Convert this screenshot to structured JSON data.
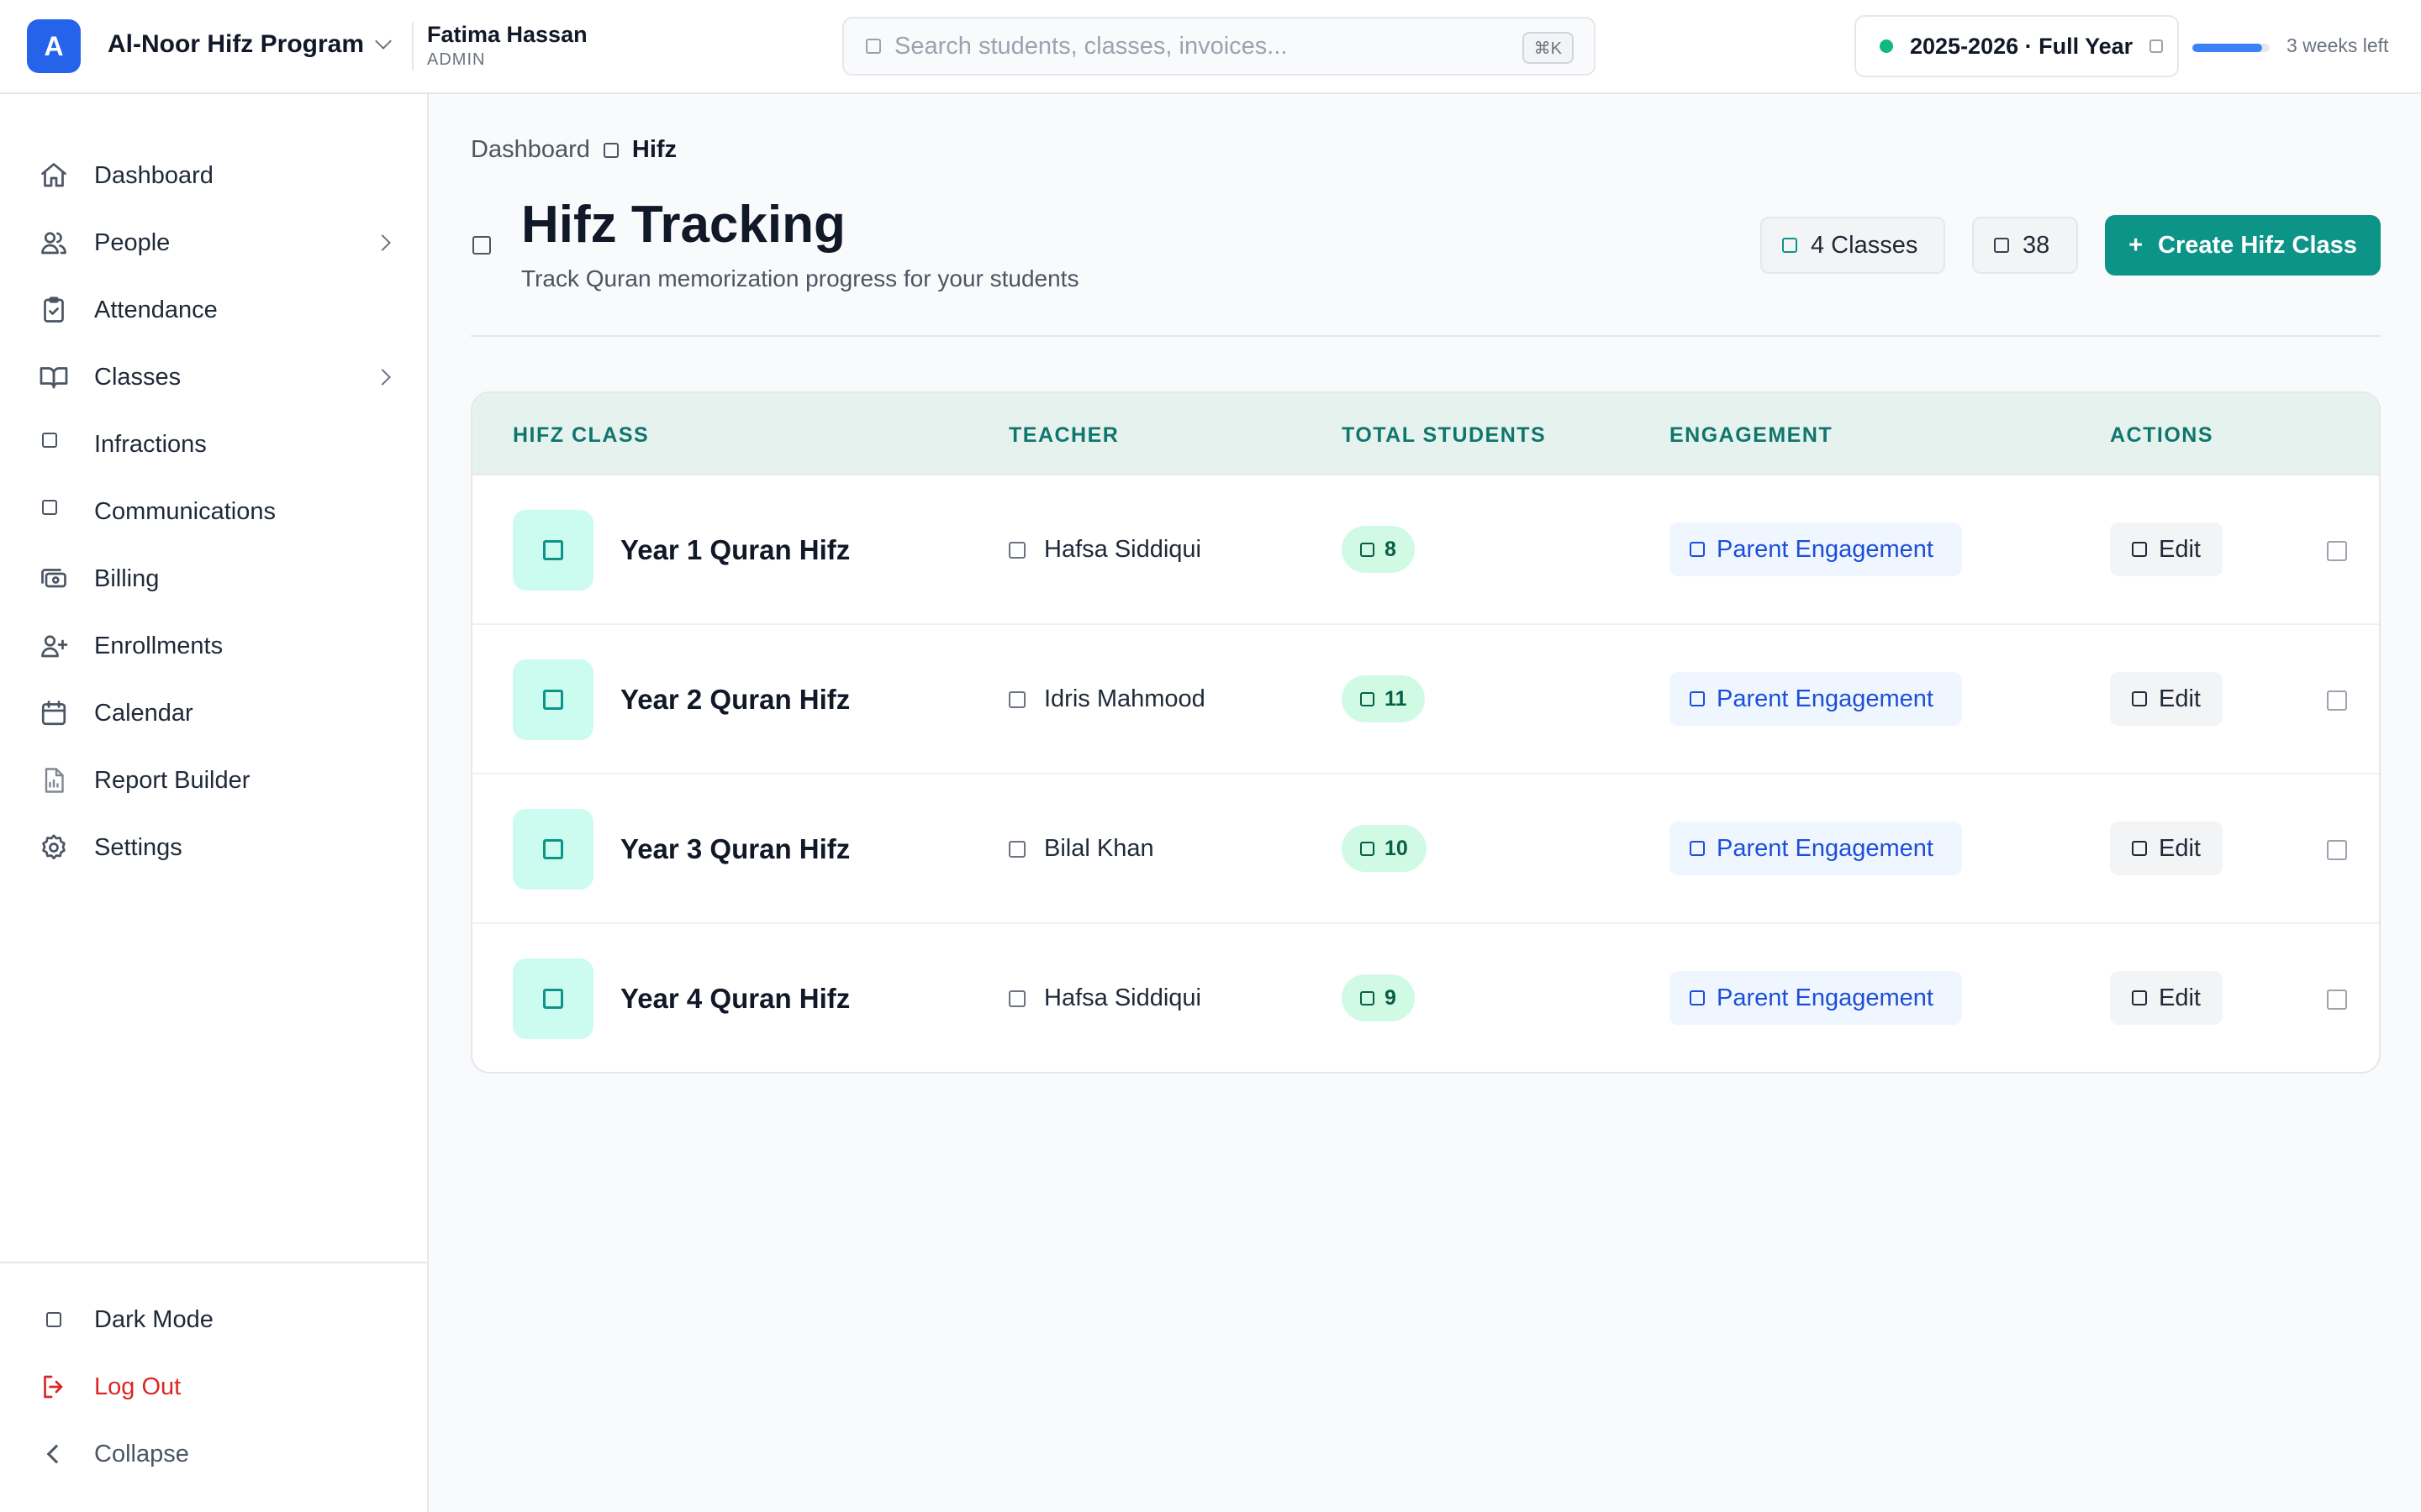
{
  "org": {
    "logo_letter": "A",
    "name": "Al-Noor Hifz Program"
  },
  "user": {
    "name": "Fatima Hassan",
    "role": "ADMIN"
  },
  "search": {
    "placeholder": "Search students, classes, invoices...",
    "shortcut": "⌘K"
  },
  "school_year": {
    "label": "2025-2026 · Full Year",
    "status_color": "#10b981",
    "remaining": "3 weeks left",
    "progress_fraction": 0.9
  },
  "sidebar": {
    "items": [
      {
        "label": "Dashboard",
        "icon": "home-icon"
      },
      {
        "label": "People",
        "icon": "people-icon",
        "has_children": true
      },
      {
        "label": "Attendance",
        "icon": "clipboard-check-icon"
      },
      {
        "label": "Classes",
        "icon": "book-open-icon",
        "has_children": true
      },
      {
        "label": "Infractions",
        "icon": "infractions-icon"
      },
      {
        "label": "Communications",
        "icon": "communications-icon"
      },
      {
        "label": "Billing",
        "icon": "billing-icon"
      },
      {
        "label": "Enrollments",
        "icon": "user-plus-icon"
      },
      {
        "label": "Calendar",
        "icon": "calendar-icon"
      },
      {
        "label": "Report Builder",
        "icon": "report-icon"
      },
      {
        "label": "Settings",
        "icon": "gear-icon"
      }
    ],
    "footer": {
      "dark_mode": "Dark Mode",
      "logout": "Log Out",
      "collapse": "Collapse"
    }
  },
  "breadcrumb": {
    "parent": "Dashboard",
    "current": "Hifz"
  },
  "page": {
    "title": "Hifz Tracking",
    "subtitle": "Track Quran memorization progress for your students",
    "classes_chip": "4 Classes",
    "students_chip": "38",
    "create_button": "Create Hifz Class",
    "accent": "#0d9488"
  },
  "table": {
    "columns": [
      "HIFZ CLASS",
      "TEACHER",
      "TOTAL STUDENTS",
      "ENGAGEMENT",
      "ACTIONS"
    ],
    "rows": [
      {
        "class": "Year 1 Quran Hifz",
        "teacher": "Hafsa Siddiqui",
        "students": "8",
        "engagement": "Parent Engagement",
        "edit": "Edit"
      },
      {
        "class": "Year 2 Quran Hifz",
        "teacher": "Idris Mahmood",
        "students": "11",
        "engagement": "Parent Engagement",
        "edit": "Edit"
      },
      {
        "class": "Year 3 Quran Hifz",
        "teacher": "Bilal Khan",
        "students": "10",
        "engagement": "Parent Engagement",
        "edit": "Edit"
      },
      {
        "class": "Year 4 Quran Hifz",
        "teacher": "Hafsa Siddiqui",
        "students": "9",
        "engagement": "Parent Engagement",
        "edit": "Edit"
      }
    ]
  }
}
